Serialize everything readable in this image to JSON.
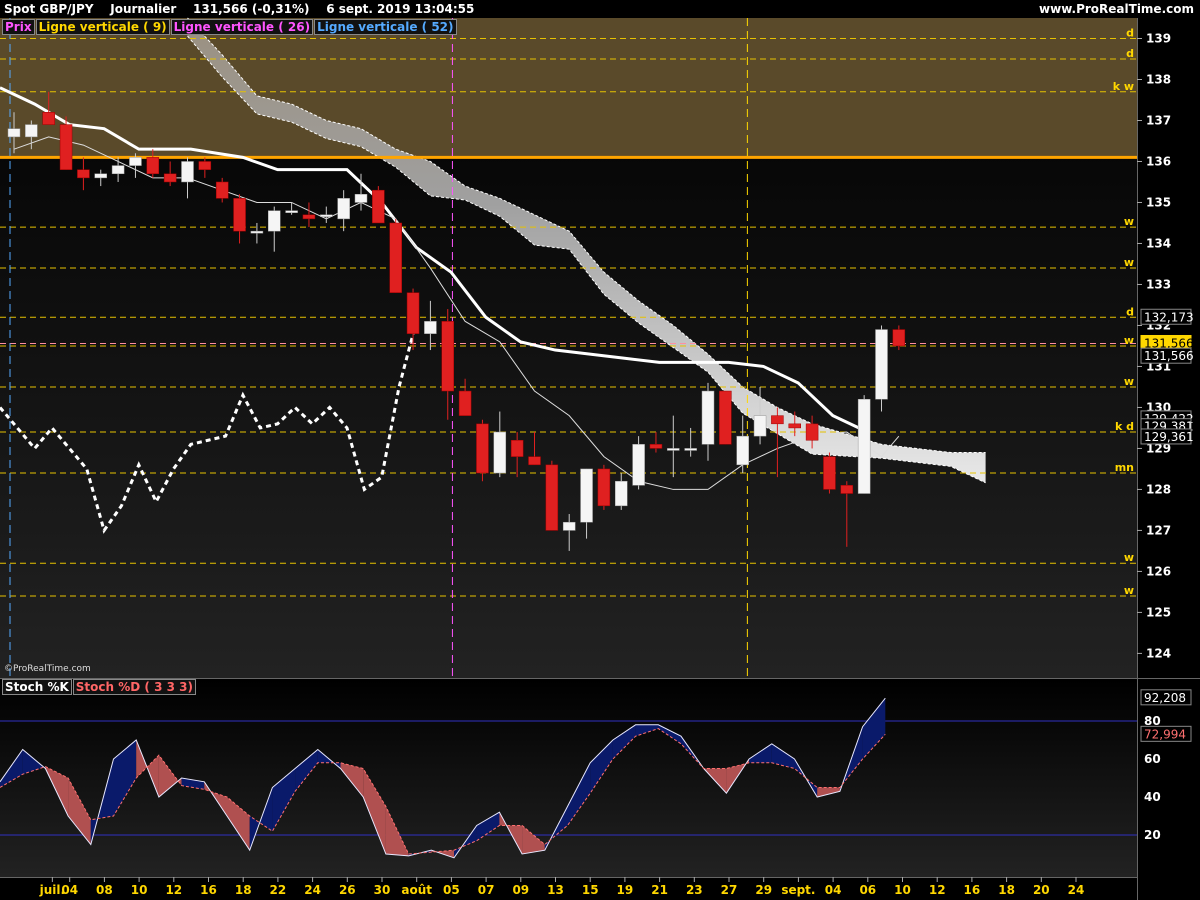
{
  "header": {
    "instrument": "Spot GBP/JPY",
    "period": "Journalier",
    "last": "131,566 (-0,31%)",
    "datetime": "6 sept. 2019 13:04:55",
    "site": "www.ProRealTime.com"
  },
  "legend": {
    "price": "Prix",
    "v9": "Ligne verticale ( 9)",
    "v26": "Ligne verticale ( 26)",
    "v52": "Ligne verticale ( 52)"
  },
  "credit": "©ProRealTime.com",
  "stoch_legend": {
    "k": "Stoch %K",
    "d": "Stoch %D ( 3 3 3)"
  },
  "price_labels": {
    "p1": "132,173",
    "p2": "131,566",
    "p3": "131,566",
    "p4": "129,422",
    "p5": "129,381",
    "p6": "129,361"
  },
  "stoch_labels": {
    "k": "92,208",
    "d": "72,994"
  },
  "level_tags": [
    "d",
    "d",
    "k w",
    "w",
    "w",
    "d",
    "w",
    "w",
    "k d",
    "mn",
    "w",
    "w"
  ],
  "chart_data": {
    "type": "candlestick",
    "ylim": [
      123.4,
      139.5
    ],
    "y_ticks": [
      124,
      125,
      126,
      127,
      128,
      129,
      130,
      131,
      132,
      133,
      134,
      135,
      136,
      137,
      138,
      139
    ],
    "x_ticks": [
      "juil.",
      "04",
      "08",
      "10",
      "12",
      "16",
      "18",
      "22",
      "24",
      "26",
      "30",
      "août",
      "05",
      "07",
      "09",
      "13",
      "15",
      "19",
      "21",
      "23",
      "27",
      "29",
      "sept.",
      "04",
      "06",
      "10",
      "12",
      "16",
      "18",
      "20",
      "24"
    ],
    "x_tick_pos": [
      1,
      2,
      4,
      6,
      8,
      10,
      12,
      14,
      16,
      18,
      20,
      22,
      24,
      26,
      28,
      30,
      32,
      34,
      36,
      38,
      40,
      42,
      44,
      46,
      48,
      50,
      52,
      54,
      56,
      58,
      60
    ],
    "candles": [
      {
        "i": 0,
        "o": 136.6,
        "h": 137.2,
        "l": 136.2,
        "c": 136.8
      },
      {
        "i": 1,
        "o": 136.6,
        "h": 137.0,
        "l": 136.3,
        "c": 136.9
      },
      {
        "i": 2,
        "o": 137.2,
        "h": 137.7,
        "l": 136.9,
        "c": 136.9
      },
      {
        "i": 3,
        "o": 136.9,
        "h": 137.1,
        "l": 135.8,
        "c": 135.8
      },
      {
        "i": 4,
        "o": 135.8,
        "h": 136.1,
        "l": 135.3,
        "c": 135.6
      },
      {
        "i": 5,
        "o": 135.6,
        "h": 135.8,
        "l": 135.4,
        "c": 135.7
      },
      {
        "i": 6,
        "o": 135.7,
        "h": 136.1,
        "l": 135.5,
        "c": 135.9
      },
      {
        "i": 7,
        "o": 135.9,
        "h": 136.2,
        "l": 135.6,
        "c": 136.1
      },
      {
        "i": 8,
        "o": 136.1,
        "h": 136.3,
        "l": 135.6,
        "c": 135.7
      },
      {
        "i": 9,
        "o": 135.7,
        "h": 136.0,
        "l": 135.4,
        "c": 135.5
      },
      {
        "i": 10,
        "o": 135.5,
        "h": 136.1,
        "l": 135.1,
        "c": 136.0
      },
      {
        "i": 11,
        "o": 136.0,
        "h": 136.1,
        "l": 135.6,
        "c": 135.8
      },
      {
        "i": 12,
        "o": 135.5,
        "h": 135.6,
        "l": 135.0,
        "c": 135.1
      },
      {
        "i": 13,
        "o": 135.1,
        "h": 135.2,
        "l": 134.0,
        "c": 134.3
      },
      {
        "i": 14,
        "o": 134.3,
        "h": 134.5,
        "l": 134.0,
        "c": 134.3
      },
      {
        "i": 15,
        "o": 134.3,
        "h": 134.9,
        "l": 133.8,
        "c": 134.8
      },
      {
        "i": 16,
        "o": 134.8,
        "h": 135.0,
        "l": 134.7,
        "c": 134.8
      },
      {
        "i": 17,
        "o": 134.7,
        "h": 135.0,
        "l": 134.4,
        "c": 134.6
      },
      {
        "i": 18,
        "o": 134.7,
        "h": 134.9,
        "l": 134.5,
        "c": 134.7
      },
      {
        "i": 19,
        "o": 134.6,
        "h": 135.3,
        "l": 134.3,
        "c": 135.1
      },
      {
        "i": 20,
        "o": 135.0,
        "h": 135.7,
        "l": 134.8,
        "c": 135.2
      },
      {
        "i": 21,
        "o": 135.3,
        "h": 135.4,
        "l": 134.5,
        "c": 134.5
      },
      {
        "i": 22,
        "o": 134.5,
        "h": 134.6,
        "l": 132.8,
        "c": 132.8
      },
      {
        "i": 23,
        "o": 132.8,
        "h": 132.9,
        "l": 131.4,
        "c": 131.8
      },
      {
        "i": 24,
        "o": 131.8,
        "h": 132.6,
        "l": 131.4,
        "c": 132.1
      },
      {
        "i": 25,
        "o": 132.1,
        "h": 132.4,
        "l": 129.7,
        "c": 130.4
      },
      {
        "i": 26,
        "o": 130.4,
        "h": 130.7,
        "l": 129.8,
        "c": 129.8
      },
      {
        "i": 27,
        "o": 129.6,
        "h": 129.7,
        "l": 128.2,
        "c": 128.4
      },
      {
        "i": 28,
        "o": 128.4,
        "h": 129.9,
        "l": 128.3,
        "c": 129.4
      },
      {
        "i": 29,
        "o": 129.2,
        "h": 129.4,
        "l": 128.3,
        "c": 128.8
      },
      {
        "i": 30,
        "o": 128.8,
        "h": 129.4,
        "l": 128.6,
        "c": 128.6
      },
      {
        "i": 31,
        "o": 128.6,
        "h": 128.7,
        "l": 127.0,
        "c": 127.0
      },
      {
        "i": 32,
        "o": 127.0,
        "h": 127.4,
        "l": 126.5,
        "c": 127.2
      },
      {
        "i": 33,
        "o": 127.2,
        "h": 128.5,
        "l": 126.8,
        "c": 128.5
      },
      {
        "i": 34,
        "o": 128.5,
        "h": 128.6,
        "l": 127.5,
        "c": 127.6
      },
      {
        "i": 35,
        "o": 127.6,
        "h": 128.4,
        "l": 127.5,
        "c": 128.2
      },
      {
        "i": 36,
        "o": 128.1,
        "h": 129.3,
        "l": 128.0,
        "c": 129.1
      },
      {
        "i": 37,
        "o": 129.1,
        "h": 129.4,
        "l": 128.9,
        "c": 129.0
      },
      {
        "i": 38,
        "o": 129.0,
        "h": 129.8,
        "l": 128.3,
        "c": 129.0
      },
      {
        "i": 39,
        "o": 129.0,
        "h": 129.5,
        "l": 128.8,
        "c": 129.0
      },
      {
        "i": 40,
        "o": 129.1,
        "h": 130.6,
        "l": 128.7,
        "c": 130.4
      },
      {
        "i": 41,
        "o": 130.4,
        "h": 130.4,
        "l": 129.1,
        "c": 129.1
      },
      {
        "i": 42,
        "o": 128.6,
        "h": 129.8,
        "l": 128.4,
        "c": 129.3
      },
      {
        "i": 43,
        "o": 129.3,
        "h": 130.5,
        "l": 129.1,
        "c": 129.8
      },
      {
        "i": 44,
        "o": 129.8,
        "h": 130.0,
        "l": 128.3,
        "c": 129.6
      },
      {
        "i": 45,
        "o": 129.6,
        "h": 129.9,
        "l": 129.3,
        "c": 129.5
      },
      {
        "i": 46,
        "o": 129.6,
        "h": 129.8,
        "l": 129.0,
        "c": 129.2
      },
      {
        "i": 47,
        "o": 128.8,
        "h": 128.9,
        "l": 127.9,
        "c": 128.0
      },
      {
        "i": 48,
        "o": 128.1,
        "h": 128.2,
        "l": 126.6,
        "c": 127.9
      },
      {
        "i": 49,
        "o": 127.9,
        "h": 130.3,
        "l": 127.9,
        "c": 130.2
      },
      {
        "i": 50,
        "o": 130.2,
        "h": 132.0,
        "l": 129.9,
        "c": 131.9
      },
      {
        "i": 51,
        "o": 131.9,
        "h": 132.0,
        "l": 131.4,
        "c": 131.5
      }
    ],
    "h_levels": [
      139.0,
      138.5,
      137.7,
      134.4,
      133.4,
      132.2,
      131.5,
      130.5,
      129.4,
      128.4,
      126.2,
      125.4
    ],
    "cloud_top": [
      [
        10,
        139.5
      ],
      [
        12,
        138.6
      ],
      [
        14,
        137.6
      ],
      [
        16,
        137.4
      ],
      [
        18,
        137.0
      ],
      [
        20,
        136.8
      ],
      [
        22,
        136.3
      ],
      [
        24,
        136.0
      ],
      [
        26,
        135.4
      ],
      [
        28,
        135.1
      ],
      [
        30,
        134.7
      ],
      [
        32,
        134.3
      ],
      [
        34,
        133.3
      ],
      [
        36,
        132.6
      ],
      [
        38,
        132.0
      ],
      [
        40,
        131.3
      ],
      [
        42,
        130.5
      ],
      [
        44,
        130.0
      ],
      [
        46,
        129.6
      ],
      [
        50,
        129.1
      ],
      [
        54,
        128.9
      ],
      [
        56,
        128.9
      ]
    ],
    "cloud_bot": [
      [
        10,
        139.5
      ],
      [
        12,
        138.5
      ],
      [
        14,
        137.6
      ],
      [
        16,
        137.4
      ],
      [
        18,
        137.0
      ],
      [
        20,
        136.8
      ],
      [
        22,
        136.3
      ],
      [
        24,
        135.6
      ],
      [
        26,
        135.5
      ],
      [
        28,
        135.1
      ],
      [
        30,
        134.4
      ],
      [
        32,
        134.3
      ],
      [
        34,
        133.2
      ],
      [
        36,
        132.5
      ],
      [
        38,
        131.9
      ],
      [
        40,
        131.3
      ],
      [
        42,
        130.3
      ],
      [
        44,
        129.8
      ],
      [
        46,
        129.3
      ],
      [
        50,
        129.2
      ],
      [
        54,
        129.0
      ],
      [
        56,
        128.6
      ]
    ],
    "kijun_thick": [
      [
        0,
        137.8
      ],
      [
        2,
        137.4
      ],
      [
        4,
        136.9
      ],
      [
        6,
        136.8
      ],
      [
        8,
        136.3
      ],
      [
        11,
        136.3
      ],
      [
        14,
        136.1
      ],
      [
        16,
        135.8
      ],
      [
        18,
        135.8
      ],
      [
        20,
        135.8
      ],
      [
        22,
        135.0
      ],
      [
        24,
        133.9
      ],
      [
        26,
        133.3
      ],
      [
        28,
        132.2
      ],
      [
        30,
        131.6
      ],
      [
        32,
        131.4
      ],
      [
        34,
        131.3
      ],
      [
        36,
        131.2
      ],
      [
        38,
        131.1
      ],
      [
        40,
        131.1
      ],
      [
        42,
        131.1
      ],
      [
        44,
        131.0
      ],
      [
        46,
        130.6
      ],
      [
        48,
        129.8
      ],
      [
        50,
        129.4
      ]
    ],
    "kijun_thin": [
      [
        0,
        136.3
      ],
      [
        2,
        136.6
      ],
      [
        4,
        136.4
      ],
      [
        6,
        136.0
      ],
      [
        8,
        135.6
      ],
      [
        10,
        135.6
      ],
      [
        12,
        135.3
      ],
      [
        14,
        135.0
      ],
      [
        16,
        135.0
      ],
      [
        18,
        134.6
      ],
      [
        20,
        135.0
      ],
      [
        22,
        134.6
      ],
      [
        24,
        133.4
      ],
      [
        26,
        132.1
      ],
      [
        28,
        131.6
      ],
      [
        30,
        130.4
      ],
      [
        32,
        129.8
      ],
      [
        34,
        128.8
      ],
      [
        36,
        128.2
      ],
      [
        38,
        128.0
      ],
      [
        40,
        128.0
      ],
      [
        42,
        128.6
      ],
      [
        44,
        129.0
      ],
      [
        46,
        129.3
      ],
      [
        48,
        129.4
      ],
      [
        50,
        128.8
      ],
      [
        51,
        129.3
      ]
    ],
    "chikou": [
      [
        0,
        130.0
      ],
      [
        1,
        129.5
      ],
      [
        2,
        129.0
      ],
      [
        3,
        129.5
      ],
      [
        4,
        129.0
      ],
      [
        5,
        128.5
      ],
      [
        6,
        127.0
      ],
      [
        7,
        127.6
      ],
      [
        8,
        128.6
      ],
      [
        9,
        127.7
      ],
      [
        10,
        128.5
      ],
      [
        11,
        129.1
      ],
      [
        12,
        129.2
      ],
      [
        13,
        129.3
      ],
      [
        14,
        130.3
      ],
      [
        15,
        129.5
      ],
      [
        16,
        129.6
      ],
      [
        17,
        130.0
      ],
      [
        18,
        129.6
      ],
      [
        19,
        130.0
      ],
      [
        20,
        129.5
      ],
      [
        21,
        128.0
      ],
      [
        22,
        128.3
      ],
      [
        23,
        130.5
      ],
      [
        24,
        132.1
      ]
    ],
    "resistance": 136.1,
    "v_lines": [
      0,
      25.5,
      42.5
    ],
    "stoch": {
      "ylim": [
        0,
        100
      ],
      "y_ticks": [
        20,
        40,
        60,
        80
      ],
      "k": [
        [
          0,
          48
        ],
        [
          1,
          65
        ],
        [
          2,
          55
        ],
        [
          3,
          30
        ],
        [
          4,
          15
        ],
        [
          5,
          60
        ],
        [
          6,
          70
        ],
        [
          7,
          40
        ],
        [
          8,
          50
        ],
        [
          9,
          48
        ],
        [
          10,
          30
        ],
        [
          11,
          12
        ],
        [
          12,
          45
        ],
        [
          13,
          55
        ],
        [
          14,
          65
        ],
        [
          15,
          55
        ],
        [
          16,
          40
        ],
        [
          17,
          10
        ],
        [
          18,
          9
        ],
        [
          19,
          12
        ],
        [
          20,
          8
        ],
        [
          21,
          25
        ],
        [
          22,
          32
        ],
        [
          23,
          10
        ],
        [
          24,
          12
        ],
        [
          25,
          35
        ],
        [
          26,
          58
        ],
        [
          27,
          70
        ],
        [
          28,
          78
        ],
        [
          29,
          78
        ],
        [
          30,
          72
        ],
        [
          31,
          55
        ],
        [
          32,
          42
        ],
        [
          33,
          60
        ],
        [
          34,
          68
        ],
        [
          35,
          60
        ],
        [
          36,
          40
        ],
        [
          37,
          43
        ],
        [
          38,
          77
        ],
        [
          39,
          92
        ]
      ],
      "d": [
        [
          0,
          45
        ],
        [
          1,
          52
        ],
        [
          2,
          56
        ],
        [
          3,
          50
        ],
        [
          4,
          28
        ],
        [
          5,
          30
        ],
        [
          6,
          50
        ],
        [
          7,
          62
        ],
        [
          8,
          46
        ],
        [
          9,
          44
        ],
        [
          10,
          40
        ],
        [
          11,
          30
        ],
        [
          12,
          22
        ],
        [
          13,
          43
        ],
        [
          14,
          58
        ],
        [
          15,
          58
        ],
        [
          16,
          55
        ],
        [
          17,
          35
        ],
        [
          18,
          10
        ],
        [
          19,
          11
        ],
        [
          20,
          12
        ],
        [
          21,
          17
        ],
        [
          22,
          25
        ],
        [
          23,
          25
        ],
        [
          24,
          15
        ],
        [
          25,
          25
        ],
        [
          26,
          42
        ],
        [
          27,
          60
        ],
        [
          28,
          72
        ],
        [
          29,
          76
        ],
        [
          30,
          68
        ],
        [
          31,
          55
        ],
        [
          32,
          55
        ],
        [
          33,
          58
        ],
        [
          34,
          58
        ],
        [
          35,
          55
        ],
        [
          36,
          45
        ],
        [
          37,
          45
        ],
        [
          38,
          60
        ],
        [
          39,
          73
        ]
      ]
    }
  }
}
